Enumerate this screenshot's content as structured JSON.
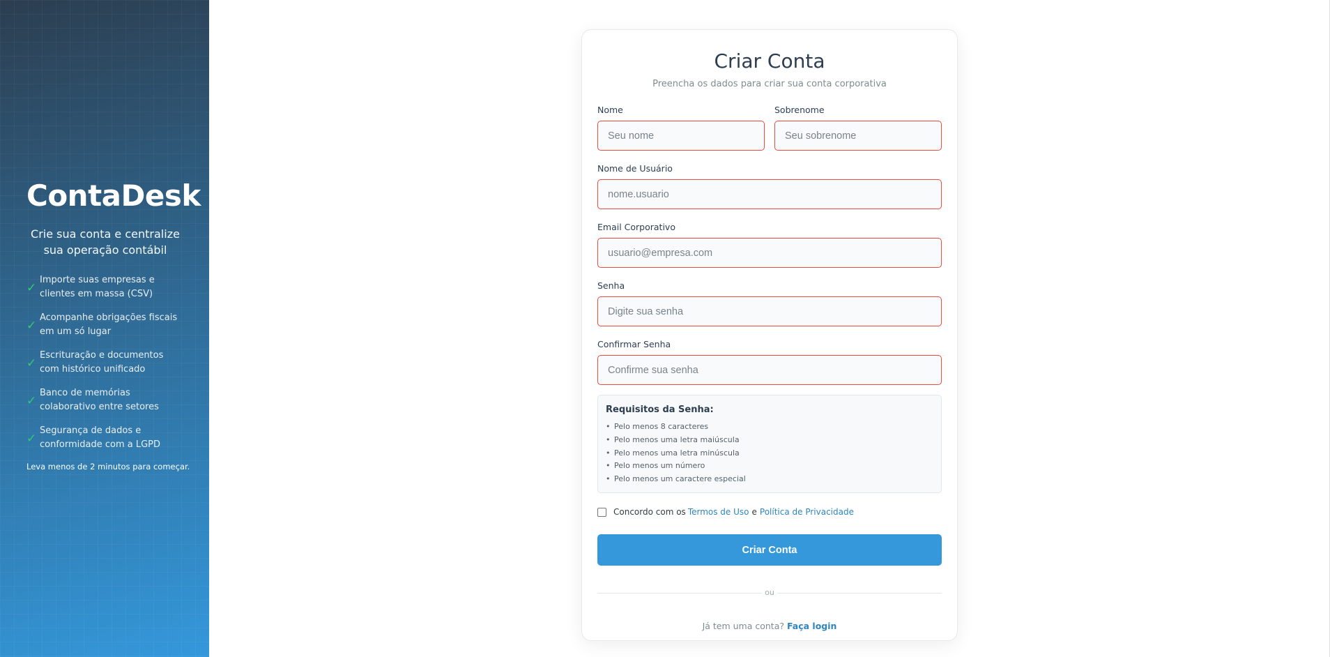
{
  "brand": {
    "title": "ContaDesk",
    "subtitle": "Crie sua conta e centralize sua operação contábil",
    "features": [
      "Importe suas empresas e clientes em massa (CSV)",
      "Acompanhe obrigações fiscais em um só lugar",
      "Escrituração e documentos com histórico unificado",
      "Banco de memórias colaborativo entre setores",
      "Segurança de dados e conformidade com a LGPD"
    ],
    "check_glyph": "✓",
    "footnote": "Leva menos de 2 minutos para começar."
  },
  "form": {
    "title": "Criar Conta",
    "subtitle": "Preencha os dados para criar sua conta corporativa",
    "fields": {
      "first_name": {
        "label": "Nome",
        "placeholder": "Seu nome",
        "value": ""
      },
      "last_name": {
        "label": "Sobrenome",
        "placeholder": "Seu sobrenome",
        "value": ""
      },
      "username": {
        "label": "Nome de Usuário",
        "placeholder": "nome.usuario",
        "value": ""
      },
      "email": {
        "label": "Email Corporativo",
        "placeholder": "usuario@empresa.com",
        "value": ""
      },
      "password": {
        "label": "Senha",
        "placeholder": "Digite sua senha",
        "value": ""
      },
      "confirm_password": {
        "label": "Confirmar Senha",
        "placeholder": "Confirme sua senha",
        "value": ""
      }
    },
    "requirements": {
      "title": "Requisitos da Senha:",
      "bullet": "•",
      "items": [
        "Pelo menos 8 caracteres",
        "Pelo menos uma letra maiúscula",
        "Pelo menos uma letra minúscula",
        "Pelo menos um número",
        "Pelo menos um caractere especial"
      ]
    },
    "terms": {
      "prefix": "Concordo com os",
      "terms_link": "Termos de Uso",
      "and": "e",
      "privacy_link": "Política de Privacidade",
      "checked": false
    },
    "submit_label": "Criar Conta",
    "divider_text": "ou",
    "login": {
      "prompt": "Já tem uma conta?",
      "link": "Faça login"
    }
  },
  "colors": {
    "primary": "#3498db",
    "error_border": "#e74c3c",
    "check": "#2ecc71",
    "panel_dark": "#2c3e50"
  }
}
